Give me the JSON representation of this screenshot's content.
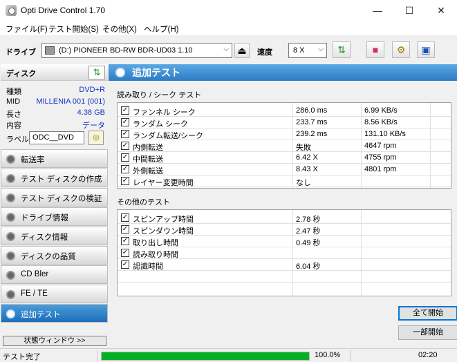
{
  "window": {
    "title": "Opti Drive Control 1.70"
  },
  "menu": [
    {
      "label": "ファイル(F)"
    },
    {
      "label": "テスト開始(S)"
    },
    {
      "label": "その他(X)"
    },
    {
      "label": "ヘルプ(H)"
    }
  ],
  "toolbar": {
    "drive_label": "ドライブ",
    "drive_value": "(D:)   PIONEER BD-RW   BDR-UD03 1.10",
    "speed_label": "速度",
    "speed_value": "8 X"
  },
  "disc": {
    "title": "ディスク",
    "rows": [
      {
        "label": "種類",
        "value": "DVD+R"
      },
      {
        "label": "MID",
        "value": "MILLENIA 001 (001)"
      },
      {
        "label": "長さ",
        "value": "4.38 GB"
      },
      {
        "label": "内容",
        "value": "データ"
      }
    ],
    "label_label": "ラベル",
    "label_value": "ODC__DVD"
  },
  "nav": [
    {
      "label": "転送率"
    },
    {
      "label": "テスト ディスクの作成"
    },
    {
      "label": "テスト ディスクの検証"
    },
    {
      "label": "ドライブ情報"
    },
    {
      "label": "ディスク情報"
    },
    {
      "label": "ディスクの品質"
    },
    {
      "label": "CD Bler"
    },
    {
      "label": "FE / TE"
    },
    {
      "label": "追加テスト"
    }
  ],
  "nav_active_index": 8,
  "status_window_label": "状態ウィンドウ >>",
  "main": {
    "title": "追加テスト",
    "read_seek_section": "読み取り / シーク テスト",
    "read_seek_rows": [
      {
        "name": "ファンネル シーク",
        "value": "286.0 ms",
        "extra": "6.99 KB/s",
        "checked": true
      },
      {
        "name": "ランダム シーク",
        "value": "233.7 ms",
        "extra": "8.56 KB/s",
        "checked": true
      },
      {
        "name": "ランダム転送/シーク",
        "value": "239.2 ms",
        "extra": "131.10 KB/s",
        "checked": true
      },
      {
        "name": "内側転送",
        "value": "失敗",
        "extra": "4647 rpm",
        "checked": true
      },
      {
        "name": "中間転送",
        "value": "6.42 X",
        "extra": "4755 rpm",
        "checked": true
      },
      {
        "name": "外側転送",
        "value": "8.43 X",
        "extra": "4801 rpm",
        "checked": true
      },
      {
        "name": "レイヤー変更時間",
        "value": "なし",
        "extra": "",
        "checked": true
      }
    ],
    "other_section": "その他のテスト",
    "other_rows": [
      {
        "name": "スピンアップ時間",
        "value": "2.78 秒",
        "checked": true
      },
      {
        "name": "スピンダウン時間",
        "value": "2.47 秒",
        "checked": true
      },
      {
        "name": "取り出し時間",
        "value": "0.49 秒",
        "checked": true
      },
      {
        "name": "読み取り時間",
        "value": "",
        "checked": true
      },
      {
        "name": "認識時間",
        "value": "6.04 秒",
        "checked": true
      }
    ],
    "start_all_label": "全て開始",
    "start_partial_label": "一部開始"
  },
  "status": {
    "text": "テスト完了",
    "progress_percent": 100,
    "progress_text": "100.0%",
    "time": "02:20"
  }
}
